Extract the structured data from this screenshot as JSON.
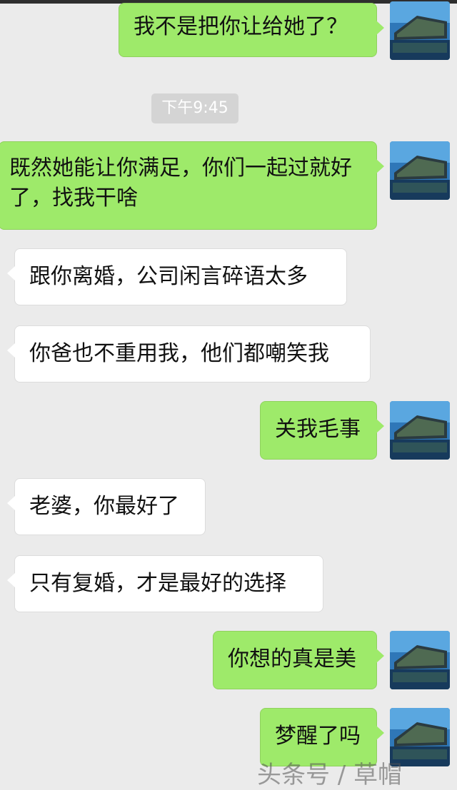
{
  "timestamp": "下午9:45",
  "messages": [
    {
      "from": "me",
      "text": "我不是把你让给她了？"
    },
    {
      "from": "me",
      "text": "既然她能让你满足，你们一起过就好了，找我干啥"
    },
    {
      "from": "them",
      "text": "跟你离婚，公司闲言碎语太多"
    },
    {
      "from": "them",
      "text": "你爸也不重用我，他们都嘲笑我"
    },
    {
      "from": "me",
      "text": "关我毛事"
    },
    {
      "from": "them",
      "text": "老婆，你最好了"
    },
    {
      "from": "them",
      "text": "只有复婚，才是最好的选择"
    },
    {
      "from": "me",
      "text": "你想的真是美"
    },
    {
      "from": "me",
      "text": "梦醒了吗"
    }
  ],
  "avatar_icon": "building-night-photo-icon",
  "watermark": "头条号 / 草帽",
  "colors": {
    "background": "#ebebeb",
    "my_bubble": "#9eea6a",
    "their_bubble": "#ffffff",
    "time_badge": "#d4d4d4"
  }
}
